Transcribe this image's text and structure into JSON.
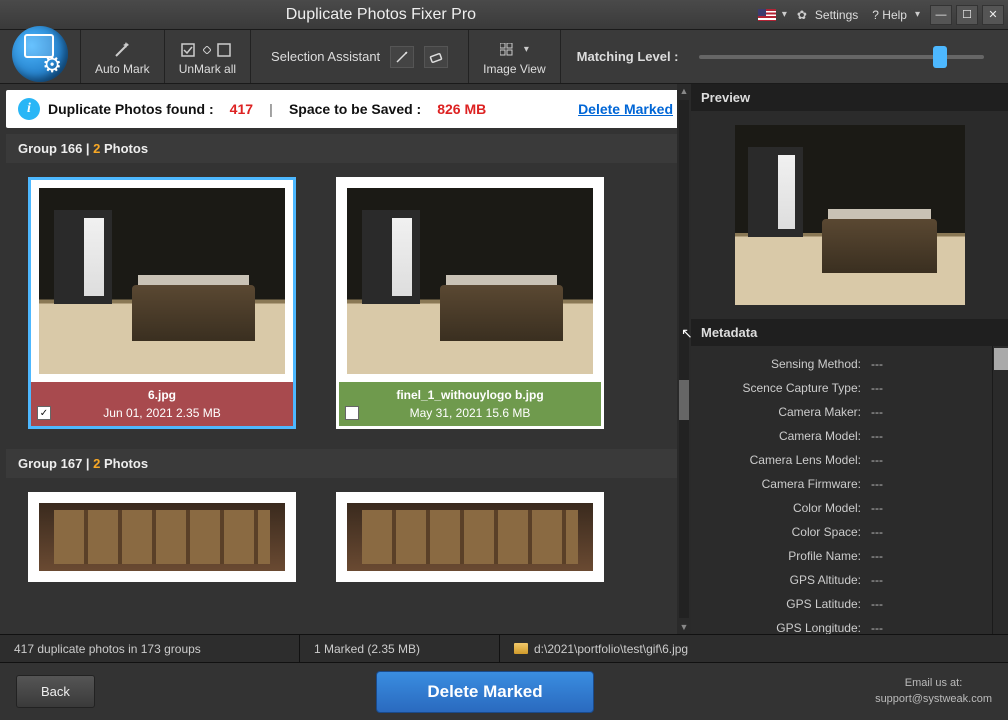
{
  "title": "Duplicate Photos Fixer Pro",
  "header": {
    "settings": "Settings",
    "help": "? Help"
  },
  "toolbar": {
    "automark": "Auto Mark",
    "unmarkall": "UnMark all",
    "selassist": "Selection Assistant",
    "imageview": "Image View",
    "matching": "Matching Level :"
  },
  "info": {
    "dup_label": "Duplicate Photos found :",
    "dup_count": "417",
    "space_label": "Space to be Saved :",
    "space_val": "826 MB",
    "delete_marked": "Delete Marked"
  },
  "groups": [
    {
      "label": "Group 166  |  ",
      "count": "2",
      "suffix": "  Photos",
      "items": [
        {
          "file": "6.jpg",
          "meta": "Jun 01, 2021    2.35 MB",
          "checked": true,
          "cap": "red"
        },
        {
          "file": "finel_1_withouylogo b.jpg",
          "meta": "May 31, 2021    15.6 MB",
          "checked": false,
          "cap": "green"
        }
      ]
    },
    {
      "label": "Group 167  |  ",
      "count": "2",
      "suffix": "  Photos"
    }
  ],
  "preview": {
    "title": "Preview"
  },
  "metadata": {
    "title": "Metadata",
    "rows": [
      {
        "k": "Sensing Method:",
        "v": "---"
      },
      {
        "k": "Scence Capture Type:",
        "v": "---"
      },
      {
        "k": "Camera Maker:",
        "v": "---"
      },
      {
        "k": "Camera Model:",
        "v": "---"
      },
      {
        "k": "Camera Lens Model:",
        "v": "---"
      },
      {
        "k": "Camera Firmware:",
        "v": "---"
      },
      {
        "k": "Color Model:",
        "v": "---"
      },
      {
        "k": "Color Space:",
        "v": "---"
      },
      {
        "k": "Profile Name:",
        "v": "---"
      },
      {
        "k": "GPS Altitude:",
        "v": "---"
      },
      {
        "k": "GPS Latitude:",
        "v": "---"
      },
      {
        "k": "GPS Longitude:",
        "v": "---"
      }
    ]
  },
  "status": {
    "counts": "417 duplicate photos in 173 groups",
    "marked": "1 Marked (2.35 MB)",
    "path": "d:\\2021\\portfolio\\test\\gif\\6.jpg"
  },
  "footer": {
    "back": "Back",
    "delete": "Delete Marked",
    "email_lead": "Email us at:",
    "email_addr": "support@systweak.com"
  }
}
